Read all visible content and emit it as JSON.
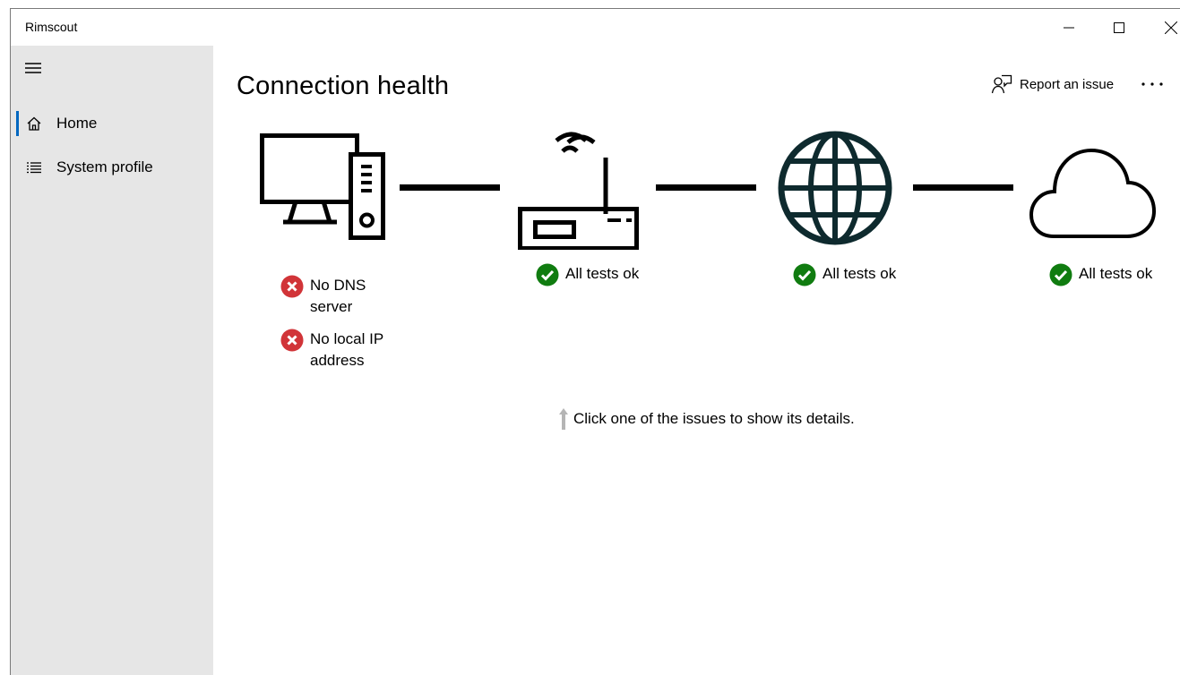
{
  "window": {
    "title": "Rimscout"
  },
  "sidebar": {
    "menu_icon": "hamburger-icon",
    "items": [
      {
        "label": "Home",
        "icon": "home-icon",
        "selected": true
      },
      {
        "label": "System profile",
        "icon": "list-icon",
        "selected": false
      }
    ]
  },
  "header": {
    "title": "Connection health",
    "report_label": "Report an issue",
    "report_icon": "feedback-icon",
    "more_icon": "more-icon"
  },
  "nodes": [
    {
      "name": "computer",
      "icon": "computer-icon",
      "statuses": [
        {
          "type": "error",
          "text": "No DNS server",
          "lines": [
            "No DNS",
            "server"
          ]
        },
        {
          "type": "error",
          "text": "No local IP address",
          "lines": [
            "No local IP",
            "address"
          ]
        }
      ]
    },
    {
      "name": "router",
      "icon": "router-icon",
      "statuses": [
        {
          "type": "ok",
          "text": "All tests ok"
        }
      ]
    },
    {
      "name": "internet",
      "icon": "globe-icon",
      "statuses": [
        {
          "type": "ok",
          "text": "All tests ok"
        }
      ]
    },
    {
      "name": "cloud",
      "icon": "cloud-icon",
      "statuses": [
        {
          "type": "ok",
          "text": "All tests ok"
        }
      ]
    }
  ],
  "hint": {
    "text": "Click one of the issues to show its details.",
    "icon": "arrow-up-icon"
  },
  "colors": {
    "sidebar_bg": "#e6e6e6",
    "accent": "#0067c0",
    "error": "#d13438",
    "ok": "#107c10",
    "globe": "#0e2a2e"
  }
}
